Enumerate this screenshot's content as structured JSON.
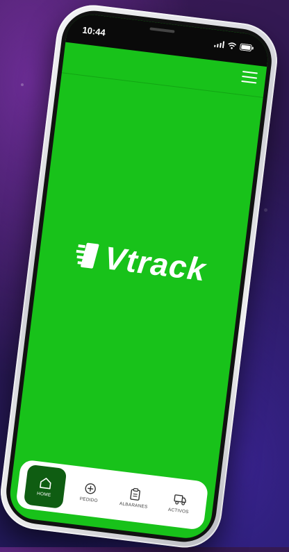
{
  "status_bar": {
    "time": "10:44",
    "icons": [
      "signal-icon",
      "wifi-icon",
      "battery-icon"
    ]
  },
  "app": {
    "logo_text": "Vtrack",
    "background_color": "#18c21a",
    "accent_color": "#0f5d12"
  },
  "top_bar": {
    "menu_icon": "hamburger-menu-icon"
  },
  "bottom_nav": {
    "items": [
      {
        "label": "HOME",
        "icon": "home-icon",
        "active": true
      },
      {
        "label": "PEDIDO",
        "icon": "add-circle-icon",
        "active": false
      },
      {
        "label": "ALBARANES",
        "icon": "clipboard-icon",
        "active": false
      },
      {
        "label": "ACTIVOS",
        "icon": "truck-icon",
        "active": false
      }
    ]
  }
}
